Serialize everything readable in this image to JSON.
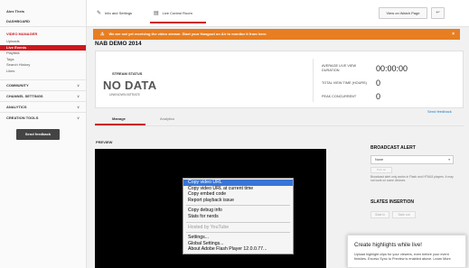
{
  "sidebar": {
    "user": "Alex Theis",
    "dashboard": "DASHBOARD",
    "section_title": "VIDEO MANAGER",
    "items": [
      {
        "label": "Uploads"
      },
      {
        "label": "Live Events"
      },
      {
        "label": "Playlists"
      },
      {
        "label": "Tags"
      },
      {
        "label": "Search History"
      },
      {
        "label": "Likes"
      }
    ],
    "groups": [
      {
        "label": "COMMUNITY"
      },
      {
        "label": "CHANNEL SETTINGS"
      },
      {
        "label": "ANALYTICS"
      },
      {
        "label": "CREATION TOOLS"
      }
    ],
    "send_feedback": "Send feedback"
  },
  "toolbar": {
    "tab_info": "Info and Settings",
    "tab_live": "Live Control Room",
    "watch_button": "View on Watch Page",
    "back_button": "↩"
  },
  "warning": {
    "text": "We are not yet receiving the video stream. Start your Hangout on Air to monitor it from here.",
    "icon": "⚠",
    "close": "×",
    "color": "#e77e22"
  },
  "event_title": "NAB DEMO 2014",
  "stream_status": {
    "label": "STREAM STATUS",
    "value": "NO DATA",
    "bitrate": "UNKNOWN BITRATE"
  },
  "metrics": [
    {
      "label": "AVERAGE LIVE VIEW DURATION",
      "value": "00:00:00"
    },
    {
      "label": "TOTAL VIEW TIME (HOURS)",
      "value": "0"
    },
    {
      "label": "PEAK CONCURRENT",
      "value": "0"
    }
  ],
  "send_feedback_link": "Send feedback",
  "manage_tabs": {
    "manage": "Manage",
    "analytics": "Analytics"
  },
  "preview_label": "PREVIEW",
  "context_menu": {
    "group1": [
      "Copy video URL",
      "Copy video URL at current time",
      "Copy embed code",
      "Report playback issue"
    ],
    "group2": [
      "Copy debug info",
      "Stats for nerds"
    ],
    "hosted_by": "Hosted by YouTube",
    "group3": [
      "Settings...",
      "Global Settings...",
      "About Adobe Flash Player 12.0.0.77..."
    ]
  },
  "broadcast_alert": {
    "title": "BROADCAST ALERT",
    "selected": "None",
    "caret": "▾",
    "turn_on": "Turn on",
    "note": "Broadcast alert only works in Flash and HTML5 players. It may not work on some devices."
  },
  "slates": {
    "title": "SLATES INSERTION",
    "slate_in": "Slate in",
    "slate_out": "Slate out"
  },
  "highlights": {
    "title": "Create highlights while live!",
    "description": "Upload highlight clips for your viewers, even before your event finishes. Excess Sync to Preview is enabled above. Learn More"
  },
  "colors": {
    "accent": "#cc181e",
    "warning": "#e77e22",
    "link": "#167ac6",
    "menu_highlight": "#3875d7"
  }
}
